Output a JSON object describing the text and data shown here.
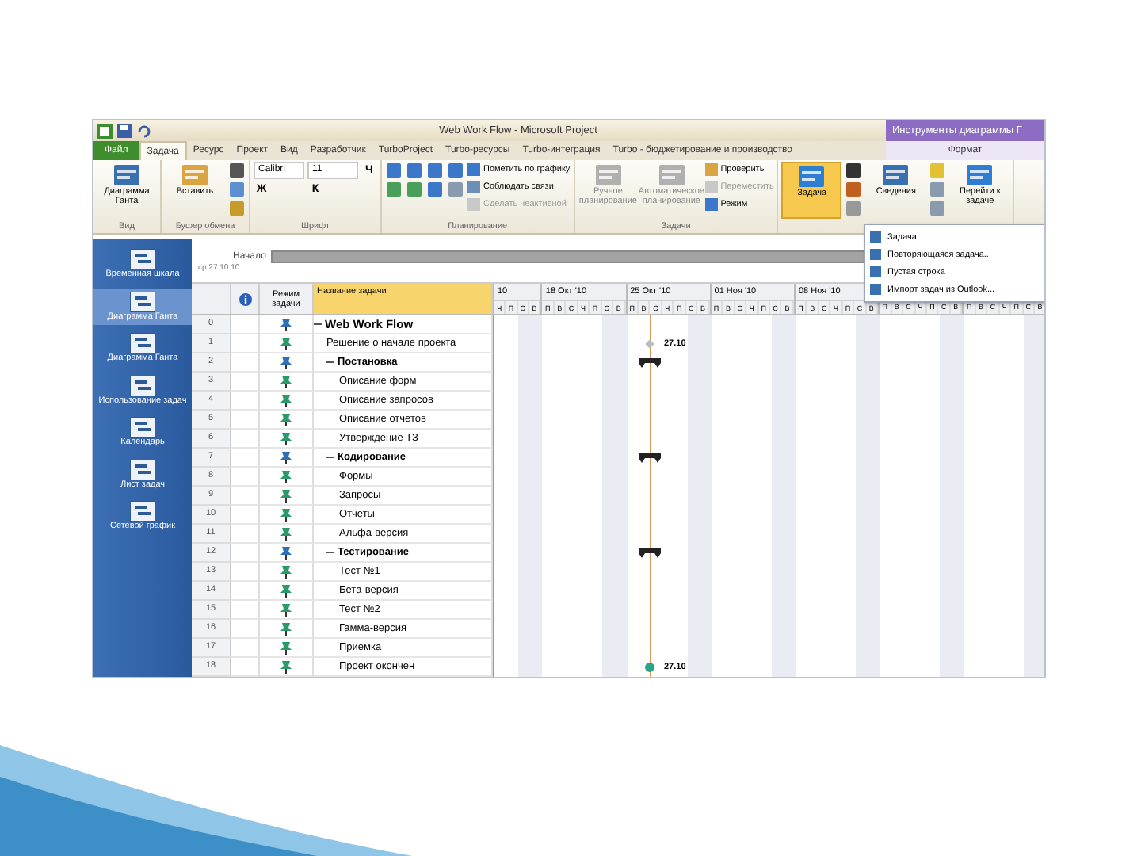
{
  "window": {
    "title": "Web Work Flow - Microsoft Project",
    "context_tab": "Инструменты диаграммы Г"
  },
  "ribbon_tabs": [
    {
      "label": "Файл",
      "kind": "file",
      "selected": false
    },
    {
      "label": "Задача",
      "kind": "tab",
      "selected": true
    },
    {
      "label": "Ресурс",
      "kind": "tab",
      "selected": false
    },
    {
      "label": "Проект",
      "kind": "tab",
      "selected": false
    },
    {
      "label": "Вид",
      "kind": "tab",
      "selected": false
    },
    {
      "label": "Разработчик",
      "kind": "tab",
      "selected": false
    },
    {
      "label": "TurboProject",
      "kind": "tab",
      "selected": false
    },
    {
      "label": "Turbo-ресурсы",
      "kind": "tab",
      "selected": false
    },
    {
      "label": "Turbo-интеграция",
      "kind": "tab",
      "selected": false
    },
    {
      "label": "Turbo - бюджетирование и производство",
      "kind": "tab",
      "selected": false
    },
    {
      "label": "Формат",
      "kind": "context",
      "selected": false
    }
  ],
  "ribbon_groups": [
    {
      "label": "Вид",
      "columns": [
        [
          {
            "kind": "large",
            "label": "Диаграмма Ганта",
            "color": "#3a6fb0"
          }
        ]
      ]
    },
    {
      "label": "Буфер обмена",
      "columns": [
        [
          {
            "kind": "large",
            "label": "Вставить",
            "color": "#d9a441"
          }
        ],
        [
          {
            "kind": "icon",
            "color": "#555555"
          },
          {
            "kind": "icon",
            "color": "#5b8fd0"
          },
          {
            "kind": "icon",
            "color": "#c79a2c"
          }
        ]
      ]
    },
    {
      "label": "Шрифт",
      "columns": [
        [
          {
            "kind": "field",
            "label": "Calibri"
          },
          {
            "kind": "glyph",
            "label": "Ж"
          }
        ],
        [
          {
            "kind": "field",
            "label": "11"
          },
          {
            "kind": "glyph",
            "label": "К"
          }
        ],
        [
          {
            "kind": "glyph",
            "label": "Ч"
          }
        ]
      ]
    },
    {
      "label": "Планирование",
      "columns": [
        [
          {
            "kind": "icon",
            "color": "#3b78c9"
          },
          {
            "kind": "icon",
            "color": "#4aa05a"
          }
        ],
        [
          {
            "kind": "icon",
            "color": "#3b78c9"
          },
          {
            "kind": "icon",
            "color": "#4aa05a"
          }
        ],
        [
          {
            "kind": "icon",
            "color": "#3b78c9"
          },
          {
            "kind": "icon",
            "color": "#3b78c9"
          }
        ],
        [
          {
            "kind": "icon",
            "color": "#3b78c9"
          },
          {
            "kind": "icon",
            "color": "#8a9bb0"
          }
        ],
        [
          {
            "kind": "small",
            "label": "Пометить по графику",
            "color": "#3b78c9"
          },
          {
            "kind": "small",
            "label": "Соблюдать связи",
            "color": "#6a8fb8"
          },
          {
            "kind": "small",
            "label": "Сделать неактивной",
            "color": "#c8c8c8",
            "disabled": true
          }
        ]
      ]
    },
    {
      "label": "Задачи",
      "columns": [
        [
          {
            "kind": "large",
            "label": "Ручное планирование",
            "color": "#b0b0b0",
            "disabled": true
          }
        ],
        [
          {
            "kind": "large",
            "label": "Автоматическое планирование",
            "color": "#b0b0b0",
            "disabled": true
          }
        ],
        [
          {
            "kind": "small",
            "label": "Проверить",
            "color": "#d9a441"
          },
          {
            "kind": "small",
            "label": "Переместить",
            "color": "#c8c8c8",
            "disabled": true
          },
          {
            "kind": "small",
            "label": "Режим",
            "color": "#3b78c9"
          }
        ]
      ]
    },
    {
      "columns": [
        [
          {
            "kind": "large",
            "label": "Задача",
            "color": "#2e7fd4",
            "expanded": true
          }
        ],
        [
          {
            "kind": "icon",
            "color": "#333333"
          },
          {
            "kind": "icon",
            "color": "#c06020"
          },
          {
            "kind": "icon",
            "color": "#999999"
          }
        ],
        [
          {
            "kind": "large",
            "label": "Сведения",
            "color": "#3a6fb0"
          }
        ],
        [
          {
            "kind": "icon",
            "color": "#e2c233"
          },
          {
            "kind": "icon",
            "color": "#8a9bb0"
          },
          {
            "kind": "icon",
            "color": "#8a9bb0"
          }
        ],
        [
          {
            "kind": "large",
            "label": "Перейти к задаче",
            "color": "#2e7fd4"
          }
        ]
      ]
    }
  ],
  "insert_menu": {
    "items": [
      {
        "label": "Задача"
      },
      {
        "label": "Повторяющаяся задача..."
      },
      {
        "label": "Пустая строка"
      },
      {
        "label": "Импорт задач из Outlook..."
      }
    ]
  },
  "views": [
    {
      "label": "Временная шкала",
      "selected": false
    },
    {
      "label": "Диаграмма Ганта",
      "selected": true
    },
    {
      "label": "Диаграмма Ганта",
      "selected": false
    },
    {
      "label": "Использование задач",
      "selected": false
    },
    {
      "label": "Календарь",
      "selected": false
    },
    {
      "label": "Лист задач",
      "selected": false
    },
    {
      "label": "Сетевой график",
      "selected": false
    }
  ],
  "timeline": {
    "label": "Начало",
    "date": "ср 27.10.10"
  },
  "table": {
    "columns": [
      "Режим задачи",
      "Название задачи"
    ],
    "tasks": [
      {
        "id": "0",
        "name": "Web Work Flow",
        "expanded": true,
        "children": [
          {
            "id": "1",
            "name": "Решение о начале проекта",
            "bar": {
              "kind": "milestone",
              "label": "27.10"
            }
          },
          {
            "id": "2",
            "name": "Постановка",
            "expanded": true,
            "bar": {
              "kind": "summary"
            },
            "children": [
              {
                "id": "3",
                "name": "Описание форм"
              },
              {
                "id": "4",
                "name": "Описание запросов"
              },
              {
                "id": "5",
                "name": "Описание отчетов"
              },
              {
                "id": "6",
                "name": "Утверждение ТЗ"
              }
            ]
          },
          {
            "id": "7",
            "name": "Кодирование",
            "expanded": true,
            "bar": {
              "kind": "summary"
            },
            "children": [
              {
                "id": "8",
                "name": "Формы"
              },
              {
                "id": "9",
                "name": "Запросы"
              },
              {
                "id": "10",
                "name": "Отчеты"
              },
              {
                "id": "11",
                "name": "Альфа-версия"
              }
            ]
          },
          {
            "id": "12",
            "name": "Тестирование",
            "expanded": true,
            "bar": {
              "kind": "summary"
            },
            "children": [
              {
                "id": "13",
                "name": "Тест №1"
              },
              {
                "id": "14",
                "name": "Бета-версия"
              },
              {
                "id": "15",
                "name": "Тест №2"
              },
              {
                "id": "16",
                "name": "Гамма-версия"
              },
              {
                "id": "17",
                "name": "Приемка"
              },
              {
                "id": "18",
                "name": "Проект окончен",
                "bar": {
                  "kind": "done",
                  "label": "27.10"
                }
              }
            ]
          }
        ]
      }
    ]
  },
  "gantt": {
    "weeks": [
      {
        "label": "10",
        "days": [
          "Ч",
          "П",
          "С",
          "В"
        ]
      },
      {
        "label": "18 Окт '10",
        "days": [
          "П",
          "В",
          "С",
          "Ч",
          "П",
          "С",
          "В"
        ]
      },
      {
        "label": "25 Окт '10",
        "days": [
          "П",
          "В",
          "С",
          "Ч",
          "П",
          "С",
          "В"
        ]
      },
      {
        "label": "01 Ноя '10",
        "days": [
          "П",
          "В",
          "С",
          "Ч",
          "П",
          "С",
          "В"
        ]
      },
      {
        "label": "08 Ноя '10",
        "days": [
          "П",
          "В",
          "С",
          "Ч",
          "П",
          "С",
          "В"
        ]
      },
      {
        "days": [
          "П",
          "В",
          "С",
          "Ч",
          "П",
          "С",
          "В"
        ]
      },
      {
        "days": [
          "П",
          "В",
          "С",
          "Ч",
          "П",
          "С",
          "В"
        ]
      }
    ]
  }
}
